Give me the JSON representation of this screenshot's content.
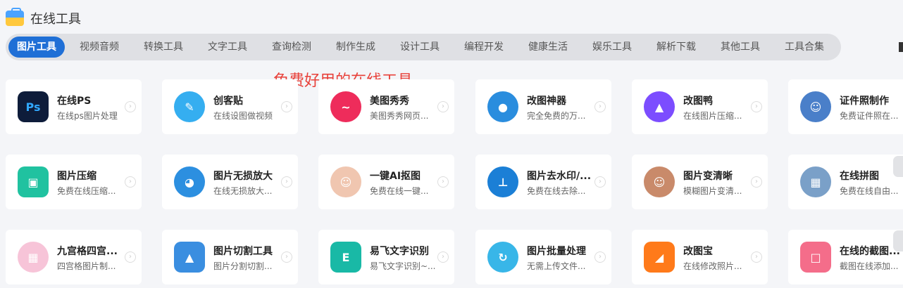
{
  "header": {
    "title": "在线工具"
  },
  "tabs": [
    "图片工具",
    "视频音频",
    "转换工具",
    "文字工具",
    "查询检测",
    "制作生成",
    "设计工具",
    "编程开发",
    "健康生活",
    "娱乐工具",
    "解析下载",
    "其他工具",
    "工具合集"
  ],
  "banner": "免费好用的在线工具",
  "cards": [
    {
      "name": "在线PS",
      "desc": "在线ps图片处理",
      "icon": "ps-icon",
      "color": "#0e1c3a"
    },
    {
      "name": "创客贴",
      "desc": "在线设图做视频",
      "icon": "chuangketie-icon",
      "color": "#35aef0"
    },
    {
      "name": "美图秀秀",
      "desc": "美图秀秀网页...",
      "icon": "meitu-icon",
      "color": "#ee2c5b"
    },
    {
      "name": "改图神器",
      "desc": "完全免费的万...",
      "icon": "monster-icon",
      "color": "#2a8dde"
    },
    {
      "name": "改图鸭",
      "desc": "在线图片压缩...",
      "icon": "duck-icon",
      "color": "#7c4dff"
    },
    {
      "name": "证件照制作",
      "desc": "免费证件照在...",
      "icon": "id-photo-icon",
      "color": "#4a7fc9"
    },
    {
      "name": "图片压缩",
      "desc": "免费在线压缩...",
      "icon": "image-compress-icon",
      "color": "#20c2a0"
    },
    {
      "name": "图片无损放大",
      "desc": "在线无损放大...",
      "icon": "doraemon-icon",
      "color": "#2c8fe0"
    },
    {
      "name": "一键AI抠图",
      "desc": "免费在线一键...",
      "icon": "cutout-icon",
      "color": "#f0c6b0"
    },
    {
      "name": "图片去水印/...",
      "desc": "免费在线去除...",
      "icon": "stamp-icon",
      "color": "#1b7fd6"
    },
    {
      "name": "图片变清晰",
      "desc": "模糊图片变清...",
      "icon": "portrait-icon",
      "color": "#c98a6a"
    },
    {
      "name": "在线拼图",
      "desc": "免费在线自由...",
      "icon": "collage-icon",
      "color": "#7aa0c8"
    },
    {
      "name": "九宫格四宫...",
      "desc": "四宫格图片制...",
      "icon": "grid-icon",
      "color": "#f7c4d8"
    },
    {
      "name": "图片切割工具",
      "desc": "图片分割切割...",
      "icon": "mountain-icon",
      "color": "#3a8ee0"
    },
    {
      "name": "易飞文字识别",
      "desc": "易飞文字识别~...",
      "icon": "ocr-icon",
      "color": "#19b9a6"
    },
    {
      "name": "图片批量处理",
      "desc": "无需上传文件...",
      "icon": "batch-icon",
      "color": "#38b6e8"
    },
    {
      "name": "改图宝",
      "desc": "在线修改照片...",
      "icon": "gaitubao-icon",
      "color": "#ff7a1a"
    },
    {
      "name": "在线的截图...",
      "desc": "截图在线添加...",
      "icon": "crop-icon",
      "color": "#f46d8a"
    }
  ]
}
